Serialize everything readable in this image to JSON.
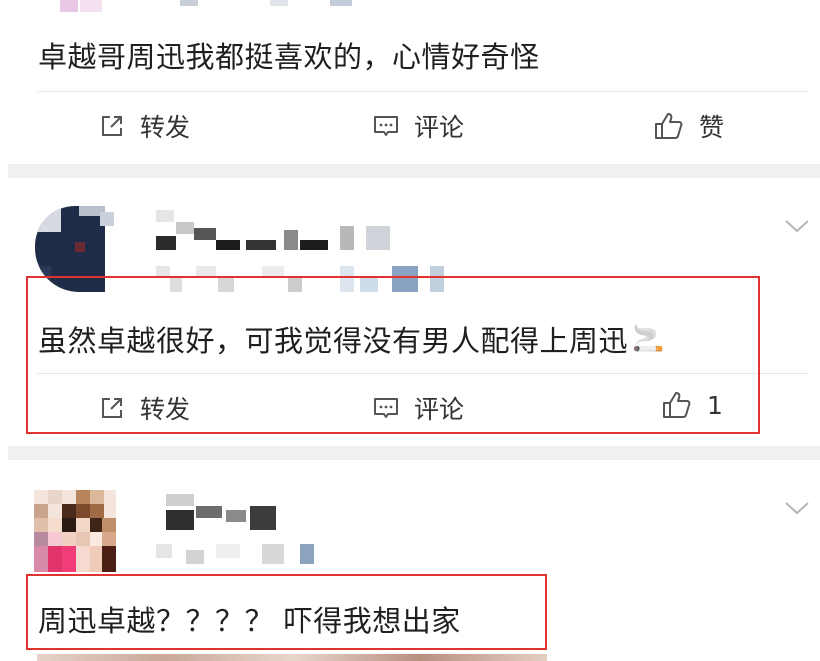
{
  "posts": [
    {
      "text": "卓越哥周迅我都挺喜欢的，心情好奇怪",
      "actions": {
        "repost": "转发",
        "comment": "评论",
        "like": "赞"
      }
    },
    {
      "text": "虽然卓越很好，可我觉得没有男人配得上周迅",
      "emoji": "🚬",
      "actions": {
        "repost": "转发",
        "comment": "评论",
        "like": "1"
      }
    },
    {
      "text": "周迅卓越？？？？ 吓得我想出家"
    }
  ],
  "colors": {
    "highlight_box": "#e0332f",
    "separator": "#f0f0f0",
    "icon": "#555555"
  },
  "icons": [
    "share-icon",
    "comment-icon",
    "thumbs-up-icon",
    "chevron-down-icon",
    "avatar"
  ]
}
